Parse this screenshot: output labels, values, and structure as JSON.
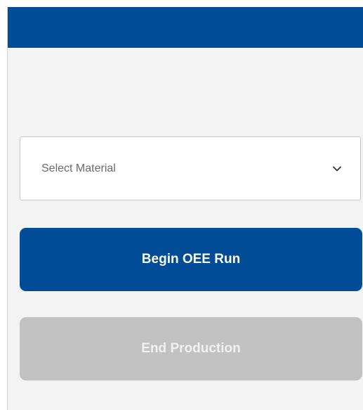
{
  "header": {
    "accent_color": "#004c97"
  },
  "material_select": {
    "placeholder": "Select Material",
    "icon": "chevron-down-icon"
  },
  "actions": {
    "begin_label": "Begin OEE Run",
    "end_label": "End Production",
    "end_disabled": true
  },
  "colors": {
    "primary": "#004c97",
    "disabled": "#c2c2c2",
    "background": "#f3f3f3"
  }
}
